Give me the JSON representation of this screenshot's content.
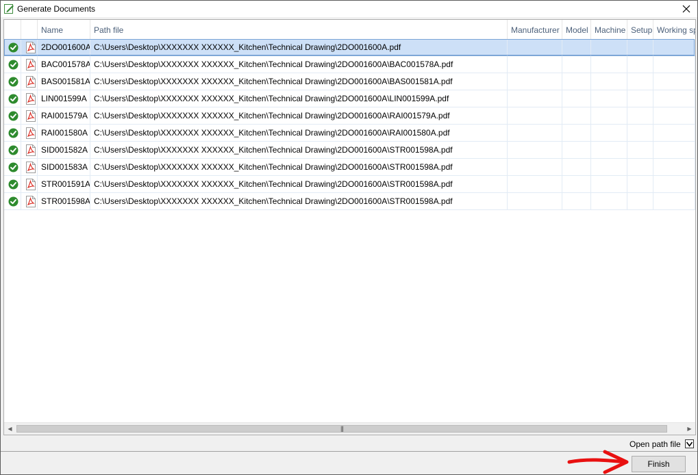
{
  "window": {
    "title": "Generate Documents"
  },
  "icons": {
    "app": "edit-document-icon",
    "close": "close-icon",
    "status": "check-circle-icon",
    "file": "pdf-icon"
  },
  "colors": {
    "status_green": "#2e8b2e",
    "pdf_red": "#d9261c",
    "selection": "#cde0f7",
    "header_text": "#4c607a",
    "arrow_red": "#e81010"
  },
  "grid": {
    "columns": [
      {
        "key": "status",
        "label": ""
      },
      {
        "key": "type",
        "label": ""
      },
      {
        "key": "name",
        "label": "Name",
        "sorted": "ascending"
      },
      {
        "key": "path",
        "label": "Path file"
      },
      {
        "key": "manufacturer",
        "label": "Manufacturer"
      },
      {
        "key": "model",
        "label": "Model"
      },
      {
        "key": "machine",
        "label": "Machine"
      },
      {
        "key": "setup",
        "label": "Setup"
      },
      {
        "key": "working",
        "label": "Working sp"
      }
    ],
    "rows": [
      {
        "name": "2DO001600A",
        "path": "C:\\Users\\Desktop\\XXXXXXX XXXXXX_Kitchen\\Technical Drawing\\2DO001600A.pdf",
        "selected": true
      },
      {
        "name": "BAC001578A",
        "path": "C:\\Users\\Desktop\\XXXXXXX XXXXXX_Kitchen\\Technical Drawing\\2DO001600A\\BAC001578A.pdf"
      },
      {
        "name": "BAS001581A",
        "path": "C:\\Users\\Desktop\\XXXXXXX XXXXXX_Kitchen\\Technical Drawing\\2DO001600A\\BAS001581A.pdf"
      },
      {
        "name": "LIN001599A",
        "path": "C:\\Users\\Desktop\\XXXXXXX XXXXXX_Kitchen\\Technical Drawing\\2DO001600A\\LIN001599A.pdf"
      },
      {
        "name": "RAI001579A",
        "path": "C:\\Users\\Desktop\\XXXXXXX XXXXXX_Kitchen\\Technical Drawing\\2DO001600A\\RAI001579A.pdf"
      },
      {
        "name": "RAI001580A",
        "path": "C:\\Users\\Desktop\\XXXXXXX XXXXXX_Kitchen\\Technical Drawing\\2DO001600A\\RAI001580A.pdf"
      },
      {
        "name": "SID001582A",
        "path": "C:\\Users\\Desktop\\XXXXXXX XXXXXX_Kitchen\\Technical Drawing\\2DO001600A\\STR001598A.pdf"
      },
      {
        "name": "SID001583A",
        "path": "C:\\Users\\Desktop\\XXXXXXX XXXXXX_Kitchen\\Technical Drawing\\2DO001600A\\STR001598A.pdf"
      },
      {
        "name": "STR001591A",
        "path": "C:\\Users\\Desktop\\XXXXXXX XXXXXX_Kitchen\\Technical Drawing\\2DO001600A\\STR001598A.pdf"
      },
      {
        "name": "STR001598A",
        "path": "C:\\Users\\Desktop\\XXXXXXX XXXXXX_Kitchen\\Technical Drawing\\2DO001600A\\STR001598A.pdf"
      }
    ],
    "scroll_glyphs": {
      "left": "◀",
      "right": "▶",
      "grip": "|||"
    }
  },
  "footer": {
    "open_path_label": "Open path file",
    "open_path_checked": true,
    "finish_label": "Finish"
  }
}
